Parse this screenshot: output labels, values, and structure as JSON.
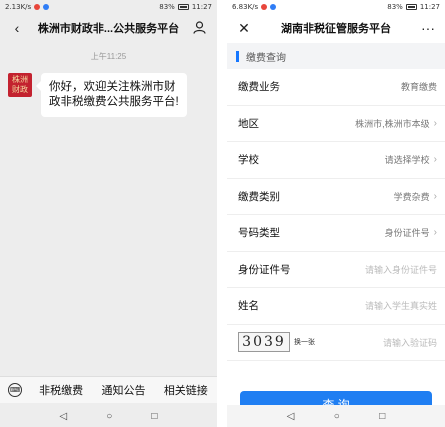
{
  "left_screen": {
    "status": {
      "left": "2.13K/s",
      "right": "83%",
      "time": "11:27"
    },
    "header": {
      "back_icon": "chevron-left-icon",
      "title": "株洲市财政非...公共服务平台",
      "profile_icon": "person-icon"
    },
    "timestamp": "上午11:25",
    "message": {
      "avatar_text": "株洲\n财政",
      "text": "你好，欢迎关注株洲市财政非税缴费公共服务平台!"
    },
    "menu": {
      "keyboard_icon": "keyboard-icon",
      "items": [
        "非税缴费",
        "通知公告",
        "相关链接"
      ]
    }
  },
  "right_screen": {
    "status": {
      "left": "6.83K/s",
      "right": "83%",
      "time": "11:27"
    },
    "header": {
      "close_icon": "close-icon",
      "title": "湖南非税征管服务平台",
      "more_icon": "more-icon"
    },
    "section_title": "缴费查询",
    "form": [
      {
        "label": "缴费业务",
        "value": "教育缴费",
        "chevron": false,
        "placeholder": false
      },
      {
        "label": "地区",
        "value": "株洲市,株洲市本级",
        "chevron": true,
        "placeholder": false
      },
      {
        "label": "学校",
        "value": "请选择学校",
        "chevron": true,
        "placeholder": false
      },
      {
        "label": "缴费类别",
        "value": "学费杂费",
        "chevron": true,
        "placeholder": false
      },
      {
        "label": "号码类型",
        "value": "身份证件号",
        "chevron": true,
        "placeholder": false
      },
      {
        "label": "身份证件号",
        "value": "请输入身份证件号",
        "chevron": false,
        "placeholder": true
      },
      {
        "label": "姓名",
        "value": "请输入学生真实姓",
        "chevron": false,
        "placeholder": true
      }
    ],
    "captcha": {
      "code": "3039",
      "refresh": "换一张",
      "placeholder": "请输入验证码"
    },
    "query_button": "查 询"
  },
  "system_nav": {
    "back": "◁",
    "home": "○",
    "recents": "□"
  },
  "colors": {
    "accent": "#1f7ef2",
    "avatar_bg": "#c3222f"
  }
}
